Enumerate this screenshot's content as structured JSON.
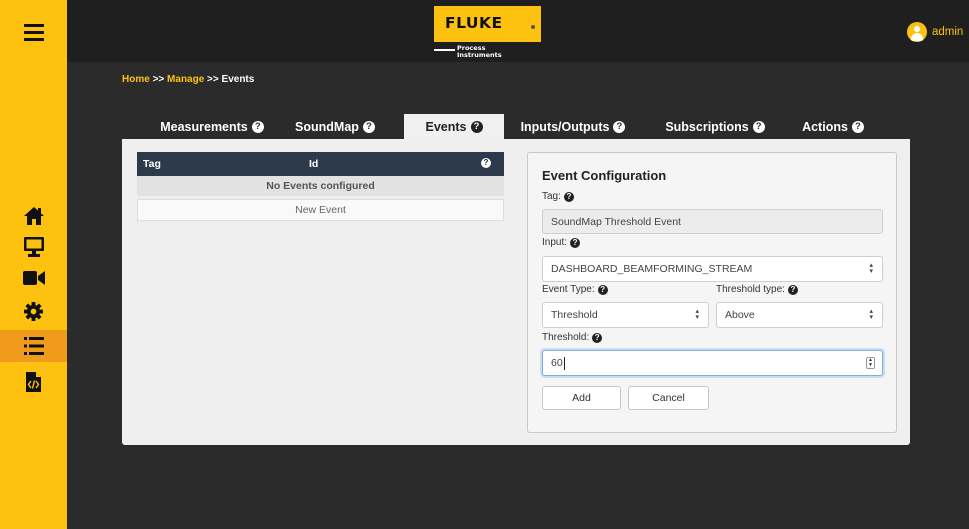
{
  "app": {
    "brand": "FLUKE",
    "brand_sub_line1": "Process",
    "brand_sub_line2": "Instruments",
    "user": "admin",
    "colors": {
      "accent": "#fdc10f",
      "active_nav": "#f19b1c",
      "header": "#1f1f1f",
      "background": "#2b2b2b"
    }
  },
  "sidebar": {
    "items": [
      {
        "icon": "menu-icon"
      },
      {
        "icon": "home-icon"
      },
      {
        "icon": "monitor-icon"
      },
      {
        "icon": "video-camera-icon"
      },
      {
        "icon": "gear-icon"
      },
      {
        "icon": "list-icon",
        "active": true
      },
      {
        "icon": "code-file-icon"
      }
    ]
  },
  "breadcrumb": {
    "home": "Home",
    "sep1": " >> ",
    "manage": "Manage",
    "sep2": " >> ",
    "current": "Events"
  },
  "tabs": [
    {
      "label": "Measurements"
    },
    {
      "label": "SoundMap"
    },
    {
      "label": "Events",
      "active": true
    },
    {
      "label": "Inputs/Outputs"
    },
    {
      "label": "Subscriptions"
    },
    {
      "label": "Actions"
    }
  ],
  "help_icon": "?",
  "events_table": {
    "columns": [
      "Tag",
      "Id"
    ],
    "empty_message": "No Events configured",
    "new_button": "New Event"
  },
  "event_config": {
    "title": "Event Configuration",
    "tag_label": "Tag:",
    "tag_value": "SoundMap Threshold Event",
    "input_label": "Input:",
    "input_value": "DASHBOARD_BEAMFORMING_STREAM",
    "event_type_label": "Event Type:",
    "event_type_value": "Threshold",
    "threshold_type_label": "Threshold type:",
    "threshold_type_value": "Above",
    "threshold_label": "Threshold:",
    "threshold_value": "60",
    "add_button": "Add",
    "cancel_button": "Cancel"
  }
}
